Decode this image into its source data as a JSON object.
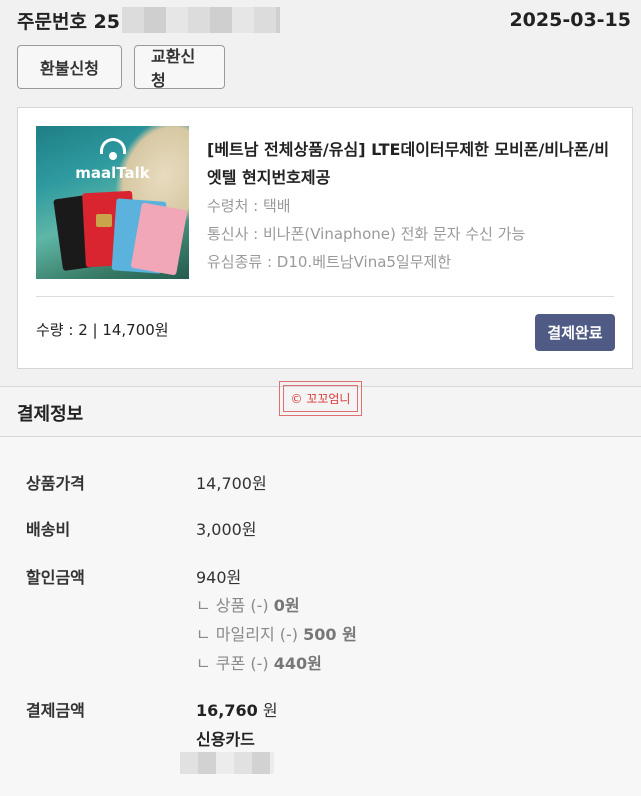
{
  "order": {
    "label_prefix": "주문번호 25",
    "date": "2025-03-15"
  },
  "actions": {
    "refund_label": "환불신청",
    "exchange_label": "교환신청"
  },
  "product": {
    "image_brand": "maalTalk",
    "title": "[베트남 전체상품/유심] LTE데이터무제한 모비폰/비나폰/비엣텔 현지번호제공",
    "receive": "수령처 : 택배",
    "carrier": "통신사 : 비나폰(Vinaphone) 전화 문자 수신 가능",
    "sim_type": "유심종류 : D10.베트남Vina5일무제한",
    "quantity": "수량 : 2 | 14,700원",
    "status": "결제완료"
  },
  "watermark": "© 꼬꼬엄니",
  "payment": {
    "section_title": "결제정보",
    "rows": {
      "price_label": "상품가격",
      "price_value": "14,700원",
      "shipping_label": "배송비",
      "shipping_value": "3,000원",
      "discount_label": "할인금액",
      "discount_value": "940원",
      "discount_item_prefix": "ㄴ 상품 (-) ",
      "discount_item_amount": "0원",
      "discount_mileage_prefix": "ㄴ 마일리지 (-) ",
      "discount_mileage_amount": "500 원",
      "discount_coupon_prefix": "ㄴ 쿠폰 (-) ",
      "discount_coupon_amount": "440원",
      "total_label": "결제금액",
      "total_amount": "16,760",
      "total_unit": " 원",
      "method": "신용카드"
    }
  }
}
